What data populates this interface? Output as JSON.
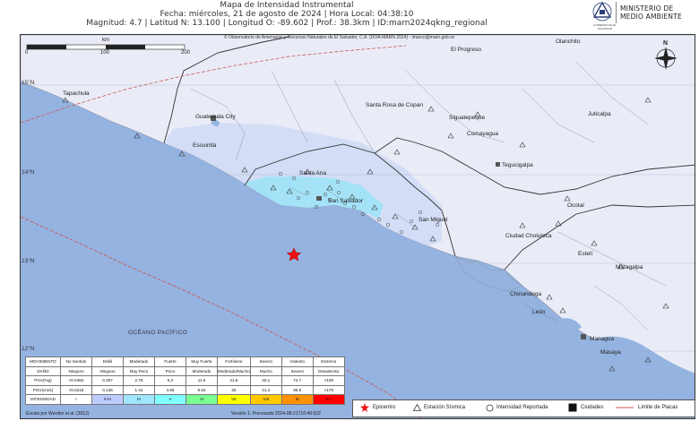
{
  "header": {
    "title": "Mapa de Intensidad Instrumental",
    "line2": "Fecha: miércoles, 21 de agosto de 2024 | Hora Local: 04:38:10",
    "line3": "Magnitud: 4.7 | Latitud N: 13.100 | Longitud O: -89.602 | Prof.: 38.3km | ID:marn2024qkng_regional"
  },
  "logo": {
    "ministry_line1": "MINISTERIO DE",
    "ministry_line2": "MEDIO AMBIENTE",
    "seal_text": "GOBIERNO DE EL SALVADOR"
  },
  "map": {
    "credit": "© Observatorio de Amenazas y Recursos Naturales de El Salvador, C.A. (DOA-MARN 2024) - imarco@marn.gob.sv",
    "scale": {
      "unit": "km",
      "labels": [
        "0",
        "100",
        "200"
      ]
    },
    "lat_labels": [
      "15°N",
      "14°N",
      "13°N",
      "12°N"
    ],
    "places": [
      "Tapachula",
      "Guatemala City",
      "Escuintla",
      "Santa Rosa de Copan",
      "El Progreso",
      "Olanchito",
      "Siguatepeque",
      "Juticalpa",
      "Comayagua",
      "Tegucigalpa",
      "Santa Ana",
      "San Salvador",
      "San Miguel",
      "Ocotal",
      "Ciudad Choluteca",
      "Estelí",
      "Matagalpa",
      "Chinandega",
      "León",
      "Managua",
      "Masaya"
    ],
    "ocean_label": "OCÉANO PACÍFICO",
    "compass": "N",
    "colors": {
      "land": "#e9ecf7",
      "ocean": "#95b3e0",
      "intensity_strong": "#9fe3f7",
      "epicenter": "#ee1111",
      "plate_boundary": "#c85a5a"
    }
  },
  "legend_table": {
    "rows": [
      {
        "label": "MOVIMIENTO",
        "cells": [
          "No Sentido",
          "Débil",
          "Moderado",
          "Fuerte",
          "Muy Fuerte",
          "Fortísimo",
          "Severo",
          "Violento",
          "Extremo"
        ]
      },
      {
        "label": "DAÑO",
        "cells": [
          "Ninguno",
          "Ninguno",
          "Muy Poco",
          "Poco",
          "Moderado",
          "Moderado/Mucho",
          "Mucho",
          "Severo",
          "Desastroso"
        ]
      },
      {
        "label": "PGA(%g)",
        "cells": [
          "<0.0464",
          "0.297",
          "2.76",
          "6.2",
          "11.5",
          "21.5",
          "40.1",
          "74.7",
          ">139"
        ]
      },
      {
        "label": "PGV(cm/s)",
        "cells": [
          "<0.0215",
          "0.135",
          "1.41",
          "4.65",
          "9.64",
          "20",
          "41.4",
          "85.8",
          ">178"
        ]
      },
      {
        "label": "INTENSIDAD",
        "cells": [
          "I",
          "II-III",
          "IV",
          "V",
          "VI",
          "VII",
          "VIII",
          "IX",
          "X+"
        ]
      }
    ],
    "intensity_colors": [
      "#ffffff",
      "#bfccff",
      "#a0e6ff",
      "#80ffff",
      "#7aff93",
      "#ffff00",
      "#ffc800",
      "#ff9100",
      "#ff0000"
    ]
  },
  "symbols": {
    "epicenter": "Epicentro",
    "station": "Estación Sísmica",
    "reported": "Intensidad Reportada",
    "cities": "Ciudades",
    "plates": "Límite de Placas"
  },
  "footer": {
    "left": "Escala por Worden et al. (2012)",
    "center": "Versión 1: Procesado 2024-08-21T10:49:52Z"
  }
}
